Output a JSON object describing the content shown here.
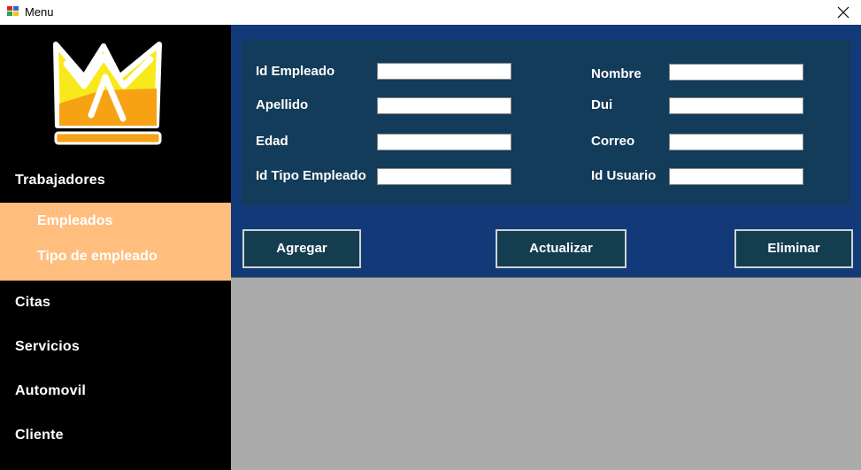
{
  "window": {
    "title": "Menu"
  },
  "sidebar": {
    "items": [
      {
        "label": "Trabajadores"
      },
      {
        "label": "Citas"
      },
      {
        "label": "Servicios"
      },
      {
        "label": "Automovil"
      },
      {
        "label": "Cliente"
      }
    ],
    "submenu": [
      {
        "label": "Empleados"
      },
      {
        "label": "Tipo de empleado"
      }
    ],
    "submenu_color": "#ffbe7e",
    "logo_icon": "crown-logo-icon"
  },
  "form": {
    "fields": [
      {
        "label": "Id Empleado",
        "value": ""
      },
      {
        "label": "Apellido",
        "value": ""
      },
      {
        "label": "Edad",
        "value": ""
      },
      {
        "label": "Id Tipo Empleado",
        "value": ""
      },
      {
        "label": "Nombre",
        "value": ""
      },
      {
        "label": "Dui",
        "value": ""
      },
      {
        "label": "Correo",
        "value": ""
      },
      {
        "label": "Id Usuario",
        "value": ""
      }
    ]
  },
  "actions": {
    "add_label": "Agregar",
    "update_label": "Actualizar",
    "delete_label": "Eliminar"
  },
  "colors": {
    "header_bg": "#133a78",
    "panel_bg": "#133b5a",
    "content_bg": "#ababab"
  }
}
